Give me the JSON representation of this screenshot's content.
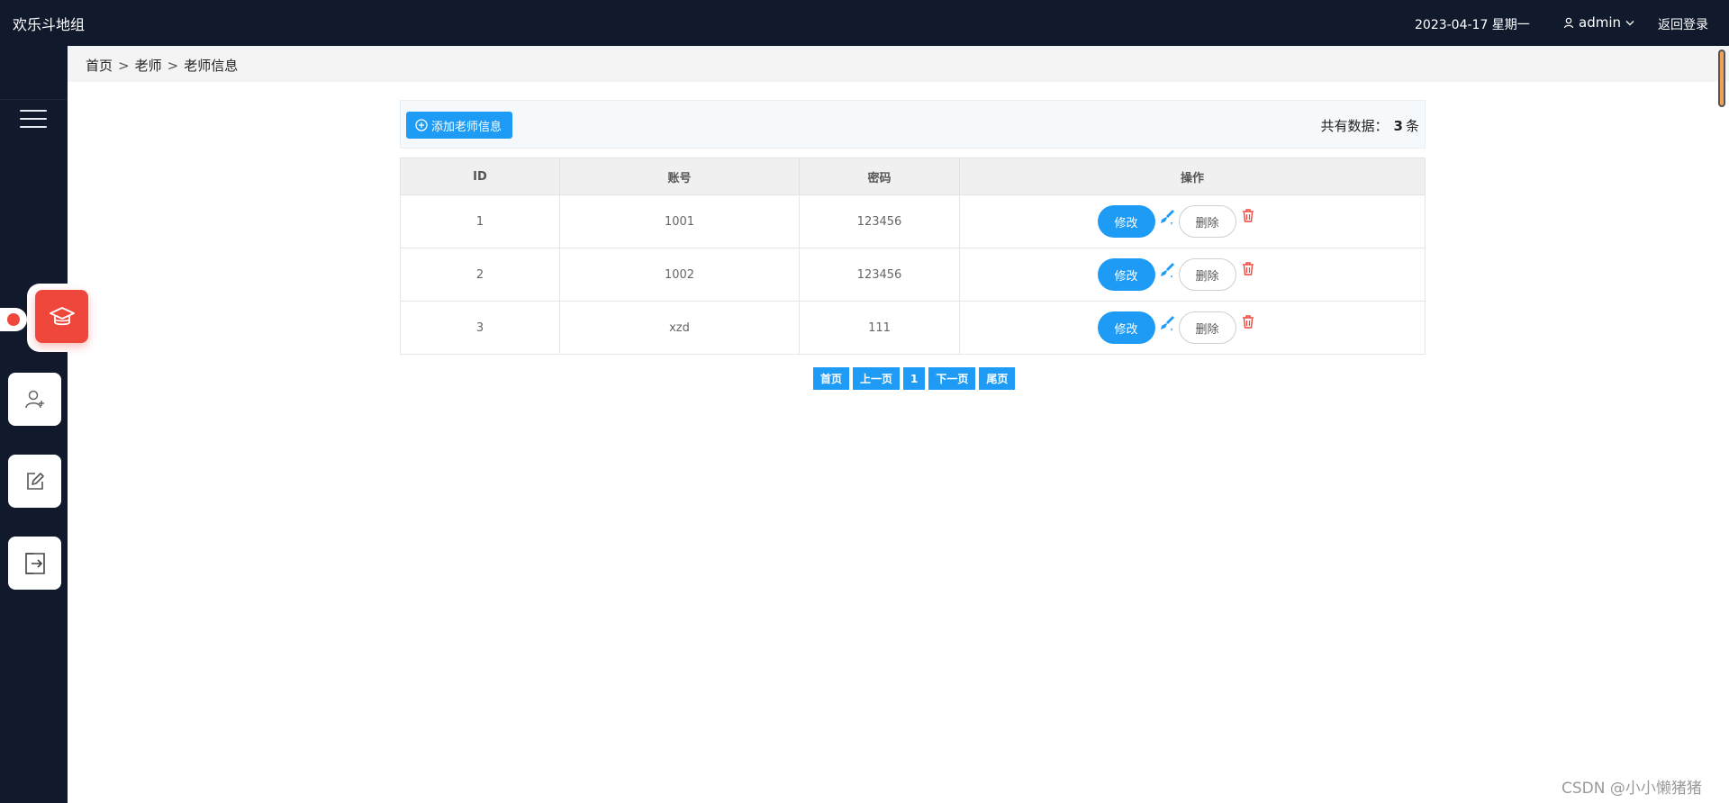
{
  "app": {
    "title": "欢乐斗地组"
  },
  "header": {
    "date": "2023-04-17 星期一",
    "username": "admin",
    "logout_label": "返回登录"
  },
  "breadcrumb": {
    "items": [
      "首页",
      "老师",
      "老师信息"
    ],
    "separator": ">"
  },
  "toolbar": {
    "add_label": "添加老师信息",
    "count_prefix": "共有数据：",
    "count_value": "3",
    "count_unit": "条"
  },
  "table": {
    "headers": [
      "ID",
      "账号",
      "密码",
      "操作"
    ],
    "rows": [
      {
        "id": "1",
        "account": "1001",
        "password": "123456"
      },
      {
        "id": "2",
        "account": "1002",
        "password": "123456"
      },
      {
        "id": "3",
        "account": "xzd",
        "password": "111"
      }
    ],
    "edit_label": "修改",
    "delete_label": "删除"
  },
  "pagination": {
    "first": "首页",
    "prev": "上一页",
    "current": "1",
    "next": "下一页",
    "last": "尾页"
  },
  "sidebar": {
    "items": [
      {
        "icon": "graduation-cap-icon",
        "active": true
      },
      {
        "icon": "add-user-icon",
        "active": false
      },
      {
        "icon": "edit-icon",
        "active": false
      },
      {
        "icon": "logout-icon",
        "active": false
      }
    ]
  },
  "colors": {
    "primary": "#1e9cf5",
    "accent_red": "#f0473d",
    "sidebar_bg": "#111a2d"
  },
  "watermark": "CSDN @小小懒猪猪"
}
